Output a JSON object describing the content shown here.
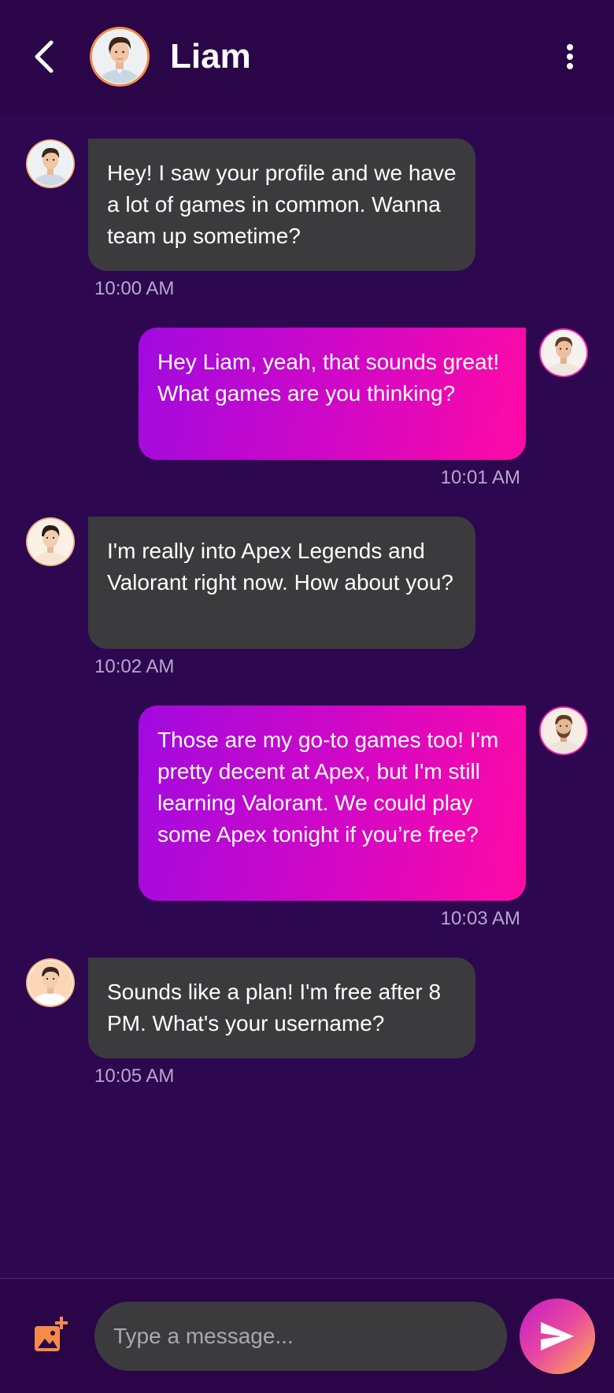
{
  "header": {
    "title": "Liam",
    "back_icon": "chevron-left-icon",
    "menu_icon": "more-vertical-icon"
  },
  "messages": [
    {
      "side": "received",
      "text": "Hey! I saw your profile and we have a lot of games in common. Wanna team up sometime?",
      "time": "10:00 AM"
    },
    {
      "side": "sent",
      "text": "Hey Liam, yeah, that sounds great! What games are you thinking?",
      "time": "10:01 AM"
    },
    {
      "side": "received",
      "text": "I'm really into Apex Legends and Valorant right now. How about you?",
      "time": "10:02 AM"
    },
    {
      "side": "sent",
      "text": "Those are my go-to games too! I'm pretty decent at Apex, but I'm still learning Valorant. We could play some Apex tonight if you’re free?",
      "time": "10:03 AM"
    },
    {
      "side": "received",
      "text": "Sounds like a plan! I'm free after 8 PM. What's your username?",
      "time": "10:05 AM"
    }
  ],
  "composer": {
    "placeholder": "Type a message...",
    "attach_icon": "add-photo-icon",
    "send_icon": "send-icon"
  },
  "colors": {
    "background": "#2d0850",
    "received_bubble": "#3b3b3d",
    "sent_gradient_start": "#a10ae0",
    "sent_gradient_end": "#ff0aa6",
    "timestamp": "#b7a6d0",
    "accent_orange": "#f58a4b"
  }
}
